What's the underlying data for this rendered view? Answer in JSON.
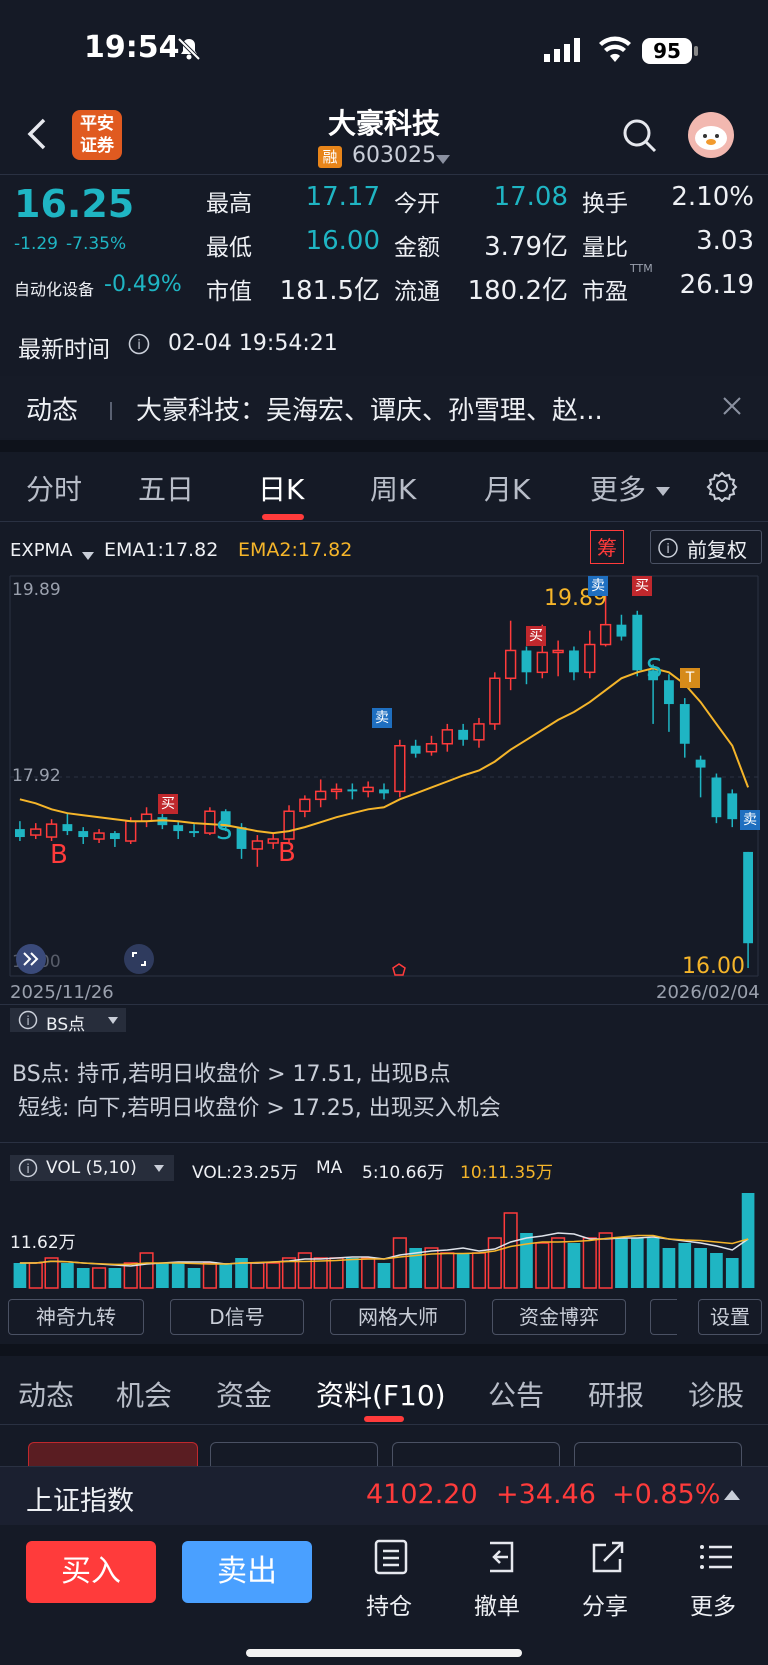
{
  "status_bar": {
    "time": "19:54",
    "battery": "95"
  },
  "header": {
    "broker_logo_text": "平安\n证券",
    "stock_name": "大豪科技",
    "margin_badge": "融",
    "stock_code": "603025"
  },
  "quote": {
    "price": "16.25",
    "change": "-1.29",
    "change_pct": "-7.35%",
    "sector_name": "自动化设备",
    "sector_change": "-0.49%",
    "fields": [
      {
        "label": "最高",
        "value": "17.17"
      },
      {
        "label": "今开",
        "value": "17.08"
      },
      {
        "label": "换手",
        "value": "2.10%"
      },
      {
        "label": "最低",
        "value": "16.00"
      },
      {
        "label": "金额",
        "value": "3.79亿"
      },
      {
        "label": "量比",
        "value": "3.03"
      },
      {
        "label": "市值",
        "value": "181.5亿"
      },
      {
        "label": "流通",
        "value": "180.2亿"
      },
      {
        "label": "市盈",
        "value": "26.19"
      }
    ],
    "pe_superscript": "TTM",
    "latest_time_label": "最新时间",
    "latest_time": "02-04 19:54:21"
  },
  "news": {
    "label": "动态",
    "text": "大豪科技：吴海宏、谭庆、孙雪理、赵..."
  },
  "period_tabs": [
    "分时",
    "五日",
    "日K",
    "周K",
    "月K",
    "更多"
  ],
  "active_period": "日K",
  "indicator": {
    "name": "EXPMA",
    "ema1": "EMA1:17.82",
    "ema2": "EMA2:17.82",
    "chip_badge": "筹",
    "adjust_label": "前复权"
  },
  "chart_data": {
    "type": "candlestick",
    "y_top_label": "19.89",
    "y_mid_label": "17.92",
    "y_bottom_label": "16.00",
    "high_marker": "19.89",
    "low_marker": "16.00",
    "x_start": "2025/11/26",
    "x_end": "2026/02/04",
    "ylim": [
      15.96,
      19.89
    ],
    "signal_labels": [
      "买",
      "卖",
      "B",
      "S",
      "T"
    ],
    "candles": [
      {
        "o": 17.4,
        "c": 17.32,
        "h": 17.48,
        "l": 17.28
      },
      {
        "o": 17.34,
        "c": 17.4,
        "h": 17.46,
        "l": 17.3
      },
      {
        "o": 17.32,
        "c": 17.45,
        "h": 17.5,
        "l": 17.28
      },
      {
        "o": 17.45,
        "c": 17.38,
        "h": 17.56,
        "l": 17.34
      },
      {
        "o": 17.38,
        "c": 17.32,
        "h": 17.42,
        "l": 17.25
      },
      {
        "o": 17.3,
        "c": 17.36,
        "h": 17.4,
        "l": 17.26
      },
      {
        "o": 17.36,
        "c": 17.3,
        "h": 17.38,
        "l": 17.22
      },
      {
        "o": 17.28,
        "c": 17.48,
        "h": 17.52,
        "l": 17.25
      },
      {
        "o": 17.48,
        "c": 17.55,
        "h": 17.62,
        "l": 17.42
      },
      {
        "o": 17.52,
        "c": 17.44,
        "h": 17.6,
        "l": 17.4
      },
      {
        "o": 17.44,
        "c": 17.38,
        "h": 17.48,
        "l": 17.3
      },
      {
        "o": 17.38,
        "c": 17.36,
        "h": 17.45,
        "l": 17.32
      },
      {
        "o": 17.36,
        "c": 17.58,
        "h": 17.62,
        "l": 17.34
      },
      {
        "o": 17.58,
        "c": 17.42,
        "h": 17.6,
        "l": 17.38
      },
      {
        "o": 17.42,
        "c": 17.2,
        "h": 17.46,
        "l": 17.1
      },
      {
        "o": 17.2,
        "c": 17.28,
        "h": 17.34,
        "l": 17.02
      },
      {
        "o": 17.26,
        "c": 17.3,
        "h": 17.36,
        "l": 17.2
      },
      {
        "o": 17.3,
        "c": 17.58,
        "h": 17.64,
        "l": 17.26
      },
      {
        "o": 17.58,
        "c": 17.7,
        "h": 17.74,
        "l": 17.52
      },
      {
        "o": 17.7,
        "c": 17.78,
        "h": 17.9,
        "l": 17.62
      },
      {
        "o": 17.78,
        "c": 17.8,
        "h": 17.86,
        "l": 17.7
      },
      {
        "o": 17.8,
        "c": 17.78,
        "h": 17.86,
        "l": 17.7
      },
      {
        "o": 17.78,
        "c": 17.82,
        "h": 17.88,
        "l": 17.72
      },
      {
        "o": 17.8,
        "c": 17.76,
        "h": 17.86,
        "l": 17.7
      },
      {
        "o": 17.78,
        "c": 18.24,
        "h": 18.3,
        "l": 17.72
      },
      {
        "o": 18.24,
        "c": 18.16,
        "h": 18.3,
        "l": 18.12
      },
      {
        "o": 18.18,
        "c": 18.26,
        "h": 18.34,
        "l": 18.14
      },
      {
        "o": 18.26,
        "c": 18.4,
        "h": 18.46,
        "l": 18.18
      },
      {
        "o": 18.4,
        "c": 18.3,
        "h": 18.46,
        "l": 18.24
      },
      {
        "o": 18.3,
        "c": 18.46,
        "h": 18.52,
        "l": 18.22
      },
      {
        "o": 18.46,
        "c": 18.92,
        "h": 18.98,
        "l": 18.4
      },
      {
        "o": 18.92,
        "c": 19.2,
        "h": 19.5,
        "l": 18.8
      },
      {
        "o": 19.2,
        "c": 18.98,
        "h": 19.24,
        "l": 18.86
      },
      {
        "o": 18.98,
        "c": 19.18,
        "h": 19.46,
        "l": 18.92
      },
      {
        "o": 19.18,
        "c": 19.2,
        "h": 19.3,
        "l": 18.94
      },
      {
        "o": 19.2,
        "c": 18.98,
        "h": 19.24,
        "l": 18.9
      },
      {
        "o": 18.98,
        "c": 19.26,
        "h": 19.4,
        "l": 18.92
      },
      {
        "o": 19.26,
        "c": 19.46,
        "h": 19.89,
        "l": 19.24
      },
      {
        "o": 19.46,
        "c": 19.34,
        "h": 19.56,
        "l": 19.3
      },
      {
        "o": 19.56,
        "c": 19.0,
        "h": 19.6,
        "l": 18.94
      },
      {
        "o": 19.0,
        "c": 18.9,
        "h": 19.06,
        "l": 18.46
      },
      {
        "o": 18.9,
        "c": 18.66,
        "h": 18.96,
        "l": 18.38
      },
      {
        "o": 18.66,
        "c": 18.26,
        "h": 18.72,
        "l": 18.12
      },
      {
        "o": 18.1,
        "c": 18.02,
        "h": 18.14,
        "l": 17.72
      },
      {
        "o": 17.92,
        "c": 17.52,
        "h": 17.96,
        "l": 17.46
      },
      {
        "o": 17.76,
        "c": 17.5,
        "h": 17.8,
        "l": 17.42
      },
      {
        "o": 17.17,
        "c": 16.25,
        "h": 17.17,
        "l": 16.0
      }
    ],
    "ema_line": [
      17.7,
      17.66,
      17.6,
      17.56,
      17.54,
      17.52,
      17.5,
      17.48,
      17.48,
      17.49,
      17.48,
      17.46,
      17.45,
      17.44,
      17.41,
      17.38,
      17.36,
      17.38,
      17.42,
      17.47,
      17.52,
      17.56,
      17.6,
      17.62,
      17.7,
      17.76,
      17.82,
      17.88,
      17.94,
      17.99,
      18.08,
      18.2,
      18.3,
      18.4,
      18.5,
      18.58,
      18.68,
      18.8,
      18.92,
      18.98,
      19.02,
      18.98,
      18.86,
      18.68,
      18.46,
      18.24,
      17.82
    ]
  },
  "bs_panel": {
    "label": "BS点",
    "line1": "BS点: 持币,若明日收盘价 > 17.51, 出现B点",
    "line2": "短线: 向下,若明日收盘价 > 17.25, 出现买入机会"
  },
  "volume": {
    "label": "VOL (5,10)",
    "vol": "VOL:23.25万",
    "ma_label": "MA",
    "ma5": "5:10.66万",
    "ma10": "10:11.35万",
    "axis_label": "11.62万",
    "bars": [
      5,
      5,
      6,
      5,
      4,
      4,
      4,
      5,
      7,
      5,
      5,
      4,
      5,
      5,
      6,
      5,
      5,
      6,
      7,
      6,
      6,
      6,
      6,
      5,
      10,
      8,
      8,
      7,
      7,
      7,
      10,
      15,
      11,
      9,
      10,
      9,
      10,
      11,
      10,
      10,
      10,
      8,
      9,
      8,
      7,
      6,
      19
    ]
  },
  "feature_buttons": [
    "神奇九转",
    "D信号",
    "网格大师",
    "资金博弈",
    "",
    "设置"
  ],
  "info_tabs": [
    "动态",
    "机会",
    "资金",
    "资料(F10)",
    "公告",
    "研报",
    "诊股"
  ],
  "active_info_tab": "资料(F10)",
  "index_bar": {
    "name": "上证指数",
    "value": "4102.20",
    "change": "+34.46",
    "change_pct": "+0.85%"
  },
  "bottom_bar": {
    "buy": "买入",
    "sell": "卖出",
    "items": [
      "持仓",
      "撤单",
      "分享",
      "更多"
    ]
  },
  "colors": {
    "up": "#ff3b3b",
    "down": "#1fb5c3",
    "bg": "#151a26",
    "ema": "#f5b52a",
    "buy_btn": "#ff3b3b",
    "sell_btn": "#4aa0ff"
  }
}
